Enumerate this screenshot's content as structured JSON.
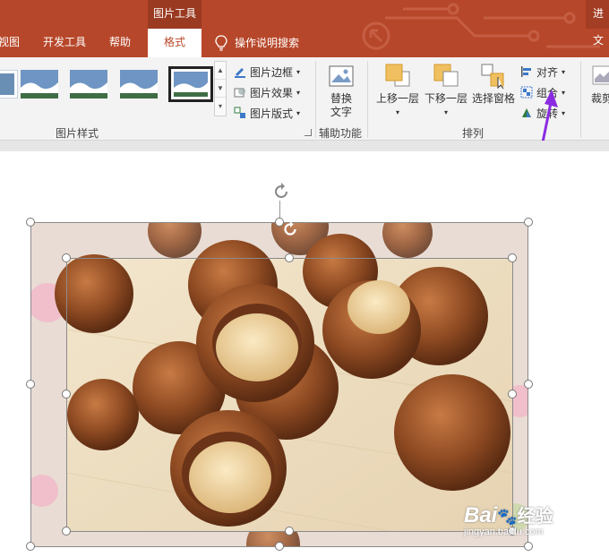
{
  "title_bar": {
    "contextual_tab_group": "图片工具",
    "share_label": "进文"
  },
  "tabs": [
    {
      "label": "视图"
    },
    {
      "label": "开发工具"
    },
    {
      "label": "帮助"
    },
    {
      "label": "格式"
    }
  ],
  "tell_me": {
    "label": "操作说明搜索"
  },
  "ribbon": {
    "picture_styles": {
      "group_label": "图片样式",
      "border_label": "图片边框",
      "effects_label": "图片效果",
      "layout_label": "图片版式"
    },
    "accessibility": {
      "group_label": "辅助功能",
      "alt_text_line1": "替换",
      "alt_text_line2": "文字"
    },
    "arrange": {
      "group_label": "排列",
      "bring_forward": "上移一层",
      "send_backward": "下移一层",
      "selection_pane": "选择窗格",
      "align": "对齐",
      "group": "组合",
      "rotate": "旋转"
    },
    "size": {
      "crop": "裁剪"
    }
  },
  "watermark": {
    "brand": "Bai",
    "brand_suffix": "经验",
    "url": "jingyan.baidu.com"
  },
  "colors": {
    "accent": "#b7472a",
    "annotation_arrow": "#8a2be2"
  },
  "icons": [
    "rotate-handle-icon",
    "lightbulb-icon",
    "picture-border-icon",
    "picture-effects-icon",
    "picture-layout-icon",
    "alt-text-icon",
    "bring-forward-icon",
    "send-backward-icon",
    "selection-pane-icon",
    "align-icon",
    "group-icon",
    "rotate-icon",
    "crop-icon"
  ]
}
